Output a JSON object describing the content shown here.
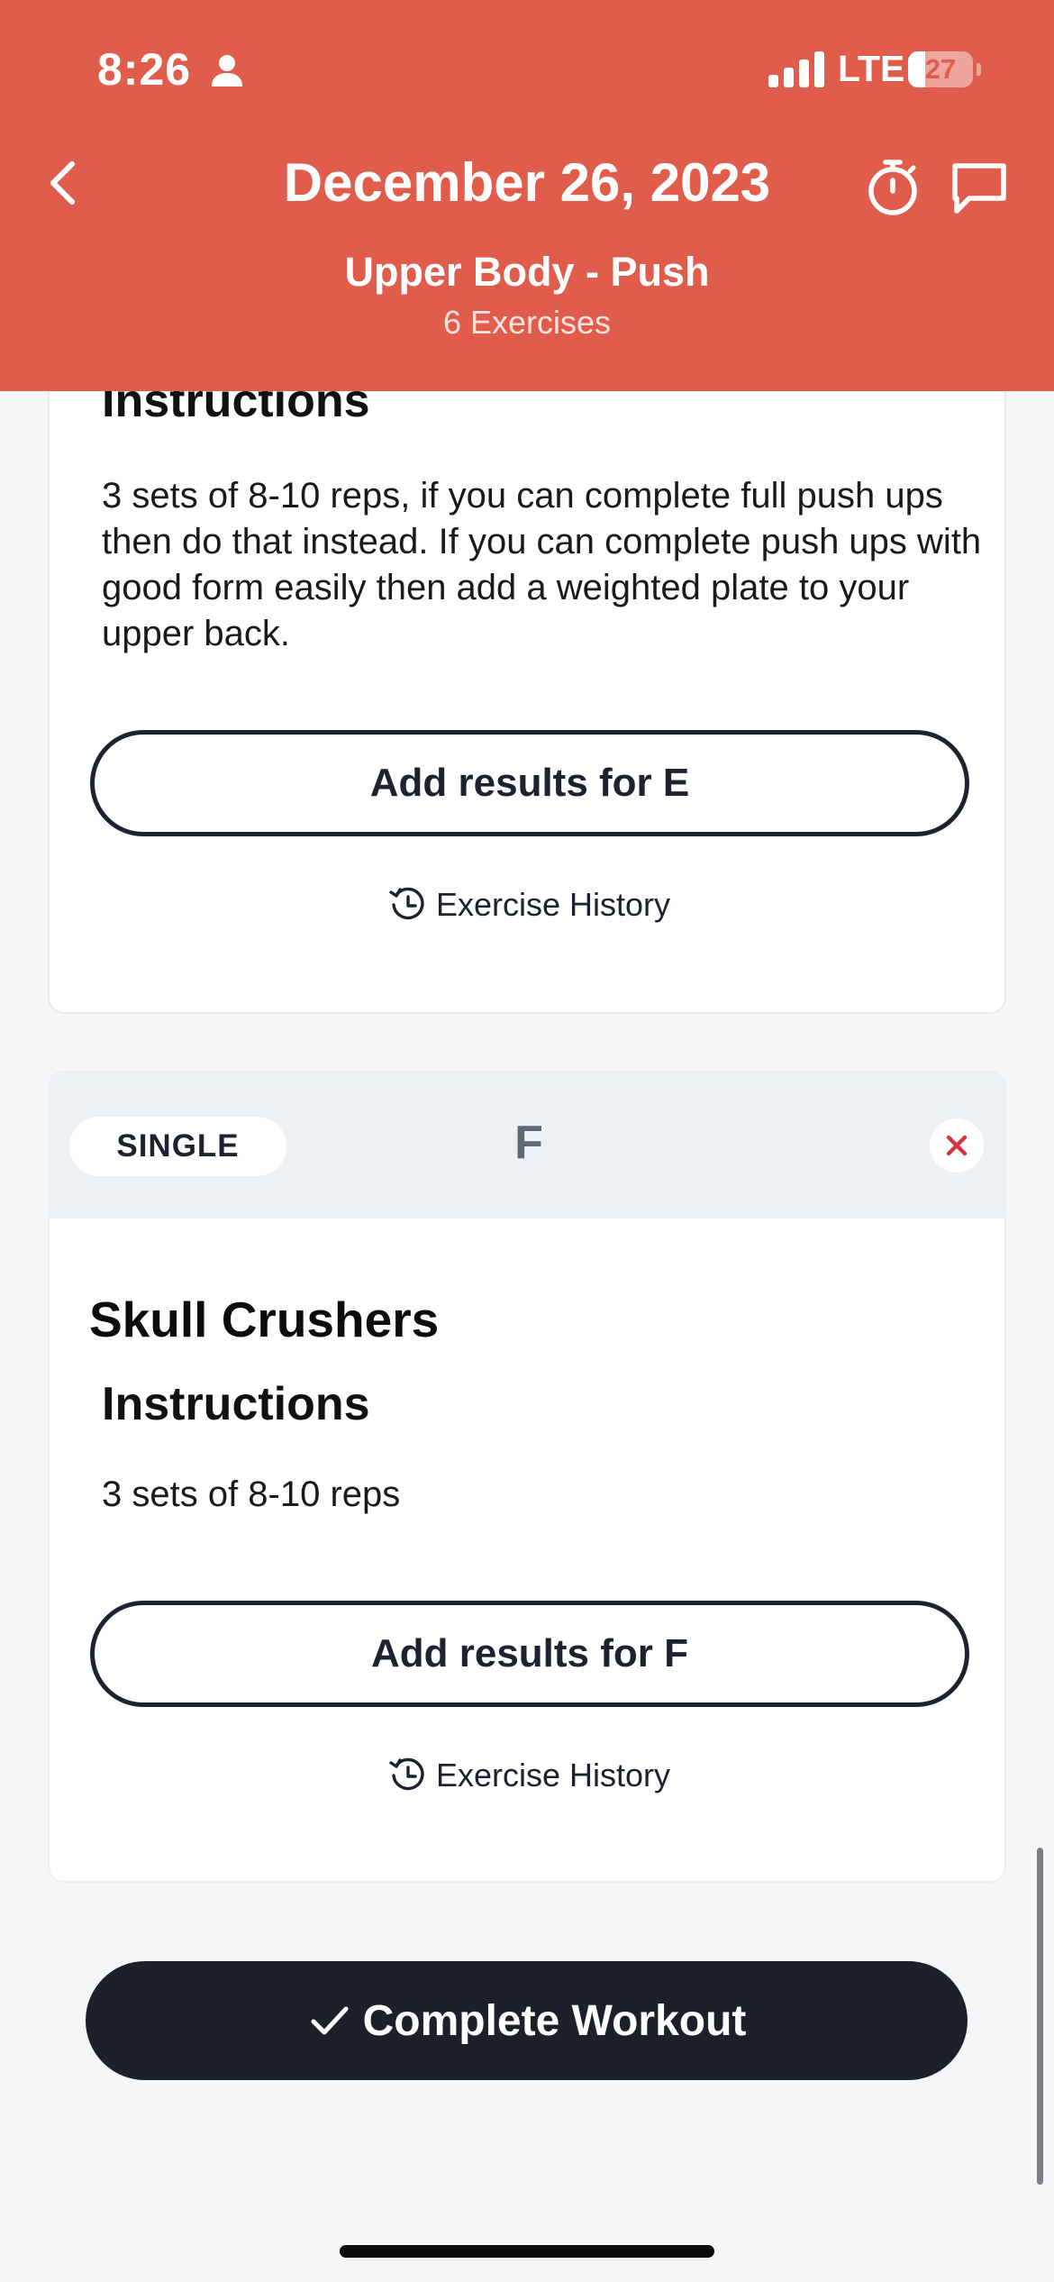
{
  "status_bar": {
    "time": "8:26",
    "network": "LTE",
    "battery_level": "27",
    "battery_fraction": 0.27
  },
  "header": {
    "title": "December 26, 2023",
    "subtitle": "Upper Body - Push",
    "exercise_count": "6 Exercises",
    "color": "#e05c4b"
  },
  "exercise_e": {
    "instructions_heading": "Instructions",
    "instructions_text": "3 sets of 8-10 reps, if you can complete full push ups then do that instead. If you can complete push ups with good form easily then add a weighted plate to your upper back.",
    "add_results_label": "Add results for E",
    "history_label": "Exercise History"
  },
  "exercise_f": {
    "type_badge": "SINGLE",
    "letter": "F",
    "name": "Skull Crushers",
    "instructions_heading": "Instructions",
    "instructions_text": "3 sets of 8-10 reps",
    "add_results_label": "Add results for F",
    "history_label": "Exercise History"
  },
  "complete_button": {
    "label": "Complete Workout"
  },
  "icons": {
    "back": "chevron-left-icon",
    "timer": "stopwatch-icon",
    "comment": "comment-icon",
    "history": "history-icon",
    "remove": "close-icon",
    "complete": "checkmark-icon"
  }
}
